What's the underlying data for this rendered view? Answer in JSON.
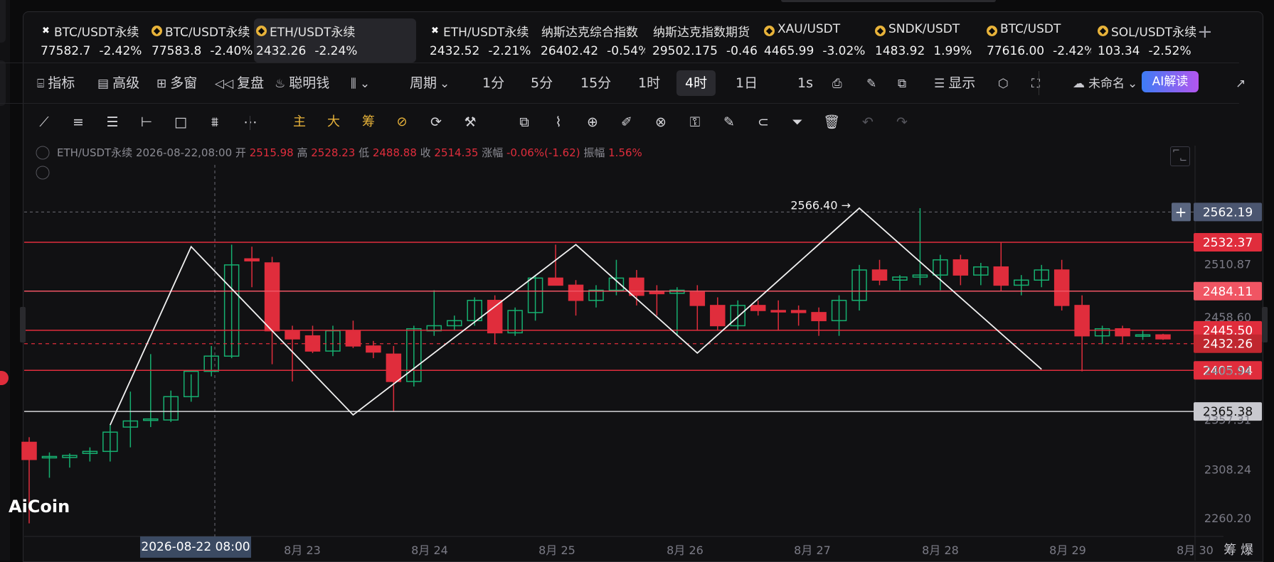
{
  "tabs": [
    {
      "icon": "x",
      "name": "BTC/USDT永续",
      "price": "77582.7",
      "change": "-2.42%",
      "dir": "down"
    },
    {
      "icon": "bn",
      "name": "BTC/USDT永续",
      "price": "77583.8",
      "change": "-2.40%",
      "dir": "down"
    },
    {
      "icon": "bn",
      "name": "ETH/USDT永续",
      "price": "2432.26",
      "change": "-2.24%",
      "dir": "down",
      "active": true
    },
    {
      "icon": "x",
      "name": "ETH/USDT永续",
      "price": "2432.52",
      "change": "-2.21%",
      "dir": "up"
    },
    {
      "icon": "",
      "name": "纳斯达克综合指数",
      "price": "26402.42",
      "change": "-0.54%",
      "dir": "down"
    },
    {
      "icon": "",
      "name": "纳斯达克指数期货",
      "price": "29502.175",
      "change": "-0.46%",
      "dir": "down"
    },
    {
      "icon": "bn",
      "name": "XAU/USDT",
      "price": "4465.99",
      "change": "-3.02%",
      "dir": "down"
    },
    {
      "icon": "bn",
      "name": "SNDK/USDT",
      "price": "1483.92",
      "change": "1.99%",
      "dir": "up"
    },
    {
      "icon": "bn",
      "name": "BTC/USDT",
      "price": "77616.00",
      "change": "-2.42%",
      "dir": "down"
    },
    {
      "icon": "bn",
      "name": "SOL/USDT永续",
      "price": "103.34",
      "change": "-2.52%",
      "dir": "down"
    }
  ],
  "toolbar": {
    "indicators": "指标",
    "advanced": "高级",
    "multi_window": "多窗",
    "replay": "复盘",
    "smart_money": "聪明钱",
    "period": "周期",
    "intervals": [
      "1分",
      "5分",
      "15分",
      "1时",
      "4时",
      "1日"
    ],
    "selected_interval": "4时",
    "seconds": "1s",
    "display": "显示",
    "layout_name": "未命名",
    "ai": "AI解读"
  },
  "draw_tools": {
    "main": "主",
    "big": "大",
    "chips": "筹"
  },
  "ohlc": {
    "symbol": "ETH/USDT永续",
    "time": "2026-08-22,08:00",
    "open_label": "开",
    "open": "2515.98",
    "high_label": "高",
    "high": "2528.23",
    "low_label": "低",
    "low": "2488.88",
    "close_label": "收",
    "close": "2514.35",
    "change_label": "涨幅",
    "change": "-0.06%(-1.62)",
    "amp_label": "振幅",
    "amp": "1.56%"
  },
  "chart_data": {
    "type": "candlestick",
    "ylim": [
      2240,
      2580
    ],
    "yticks": [
      2510.87,
      2458.6,
      2405.94,
      2357.31,
      2308.24,
      2260.2
    ],
    "xticks": [
      "8月 23",
      "8月 24",
      "8月 25",
      "8月 26",
      "8月 27",
      "8月 28",
      "8月 29",
      "8月 30"
    ],
    "crosshair_label": "2026-08-22 08:00",
    "candles": [
      [
        2335,
        2340,
        2255,
        2318
      ],
      [
        2320,
        2325,
        2300,
        2321
      ],
      [
        2320,
        2324,
        2310,
        2322
      ],
      [
        2324,
        2330,
        2316,
        2326
      ],
      [
        2326,
        2352,
        2316,
        2345
      ],
      [
        2350,
        2385,
        2330,
        2356
      ],
      [
        2357,
        2422,
        2350,
        2358
      ],
      [
        2357,
        2386,
        2355,
        2380
      ],
      [
        2380,
        2402,
        2375,
        2405
      ],
      [
        2405,
        2430,
        2400,
        2420
      ],
      [
        2420,
        2530,
        2418,
        2510
      ],
      [
        2516,
        2528,
        2488,
        2514
      ],
      [
        2512,
        2518,
        2412,
        2445
      ],
      [
        2445,
        2450,
        2395,
        2437
      ],
      [
        2440,
        2450,
        2423,
        2425
      ],
      [
        2425,
        2450,
        2420,
        2445
      ],
      [
        2445,
        2455,
        2428,
        2430
      ],
      [
        2430,
        2435,
        2418,
        2424
      ],
      [
        2422,
        2430,
        2365,
        2395
      ],
      [
        2395,
        2450,
        2390,
        2447
      ],
      [
        2445,
        2485,
        2440,
        2450
      ],
      [
        2450,
        2460,
        2445,
        2455
      ],
      [
        2455,
        2478,
        2450,
        2475
      ],
      [
        2475,
        2480,
        2432,
        2443
      ],
      [
        2443,
        2468,
        2440,
        2465
      ],
      [
        2463,
        2500,
        2455,
        2497
      ],
      [
        2497,
        2530,
        2492,
        2490
      ],
      [
        2490,
        2495,
        2460,
        2475
      ],
      [
        2475,
        2490,
        2468,
        2485
      ],
      [
        2485,
        2515,
        2480,
        2497
      ],
      [
        2497,
        2505,
        2470,
        2480
      ],
      [
        2483,
        2490,
        2460,
        2482
      ],
      [
        2482,
        2488,
        2440,
        2485
      ],
      [
        2483,
        2490,
        2445,
        2470
      ],
      [
        2470,
        2478,
        2445,
        2450
      ],
      [
        2450,
        2475,
        2445,
        2470
      ],
      [
        2470,
        2475,
        2460,
        2465
      ],
      [
        2465,
        2475,
        2445,
        2464
      ],
      [
        2465,
        2470,
        2450,
        2463
      ],
      [
        2463,
        2468,
        2440,
        2455
      ],
      [
        2455,
        2480,
        2440,
        2475
      ],
      [
        2475,
        2510,
        2465,
        2505
      ],
      [
        2505,
        2515,
        2490,
        2495
      ],
      [
        2495,
        2500,
        2485,
        2498
      ],
      [
        2498,
        2566,
        2490,
        2500
      ],
      [
        2500,
        2520,
        2485,
        2515
      ],
      [
        2515,
        2520,
        2490,
        2500
      ],
      [
        2500,
        2512,
        2490,
        2508
      ],
      [
        2508,
        2532,
        2484,
        2490
      ],
      [
        2490,
        2500,
        2480,
        2495
      ],
      [
        2495,
        2510,
        2488,
        2505
      ],
      [
        2505,
        2515,
        2465,
        2470
      ],
      [
        2470,
        2480,
        2405,
        2440
      ],
      [
        2440,
        2450,
        2432,
        2447
      ],
      [
        2447,
        2450,
        2433,
        2440
      ],
      [
        2440,
        2446,
        2436,
        2441
      ],
      [
        2441,
        2442,
        2436,
        2437
      ]
    ],
    "h_lines": [
      {
        "price": 2532.37,
        "label": "2532.37",
        "color": "#e02d3c"
      },
      {
        "price": 2484.11,
        "label": "2484.11",
        "color": "#f05563"
      },
      {
        "price": 2445.5,
        "label": "2445.50",
        "color": "#e02d3c"
      },
      {
        "price": 2405.94,
        "label": "2405.94",
        "color": "#e02d3c"
      },
      {
        "price": 2365.38,
        "label": "2365.38",
        "color": "#d4d4d8"
      }
    ],
    "current_price": {
      "price": 2432.26,
      "label": "2432.26"
    },
    "crosshair_price": {
      "price": 2562.19,
      "label": "2562.19"
    },
    "high_marker": {
      "price": 2566.4,
      "label": "2566.40 →"
    },
    "zigzag": [
      [
        4,
        2352
      ],
      [
        8,
        2528
      ],
      [
        16,
        2362
      ],
      [
        27,
        2530
      ],
      [
        33,
        2423
      ],
      [
        41,
        2566
      ],
      [
        50,
        2407
      ]
    ],
    "brand": "AiCoin",
    "watermark": "筹 爆"
  }
}
